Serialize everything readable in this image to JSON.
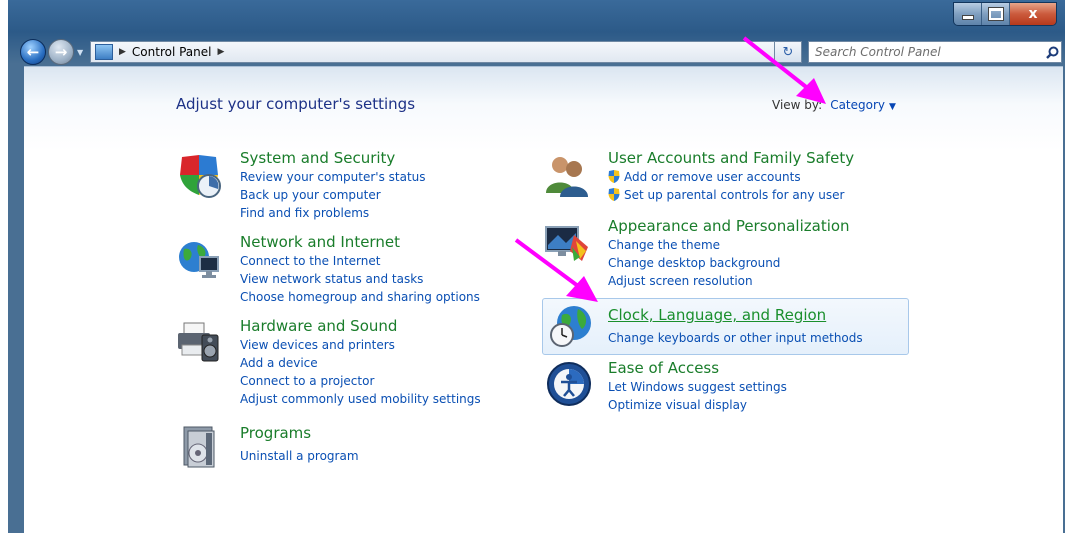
{
  "window": {
    "buttons": {
      "minimize": "",
      "maximize": "",
      "close": "x"
    }
  },
  "address": {
    "crumbs": [
      "Control Panel"
    ],
    "search_placeholder": "Search Control Panel"
  },
  "main": {
    "heading": "Adjust your computer's settings",
    "view_by_label": "View by:",
    "view_by_value": "Category"
  },
  "categories": [
    {
      "title": "System and Security",
      "icon": "shield-icon",
      "links": [
        "Review your computer's status",
        "Back up your computer",
        "Find and fix problems"
      ]
    },
    {
      "title": "Network and Internet",
      "icon": "globe-network-icon",
      "links": [
        "Connect to the Internet",
        "View network status and tasks",
        "Choose homegroup and sharing options"
      ]
    },
    {
      "title": "Hardware and Sound",
      "icon": "printer-speaker-icon",
      "links": [
        "View devices and printers",
        "Add a device",
        "Connect to a projector",
        "Adjust commonly used mobility settings"
      ]
    },
    {
      "title": "Programs",
      "icon": "programs-icon",
      "links": [
        "Uninstall a program"
      ]
    },
    {
      "title": "User Accounts and Family Safety",
      "icon": "users-icon",
      "links": [
        "Add or remove user accounts",
        "Set up parental controls for any user"
      ]
    },
    {
      "title": "Appearance and Personalization",
      "icon": "appearance-icon",
      "links": [
        "Change the theme",
        "Change desktop background",
        "Adjust screen resolution"
      ]
    },
    {
      "title": "Clock, Language, and Region",
      "icon": "clock-globe-icon",
      "links": [
        "Change keyboards or other input methods"
      ]
    },
    {
      "title": "Ease of Access",
      "icon": "ease-of-access-icon",
      "links": [
        "Let Windows suggest settings",
        "Optimize visual display"
      ]
    }
  ],
  "colors": {
    "title_green": "#1a7d2b",
    "link_blue": "#0a4fb3",
    "annotation_arrow": "#ff00ff",
    "heading_blue": "#1e3287"
  }
}
